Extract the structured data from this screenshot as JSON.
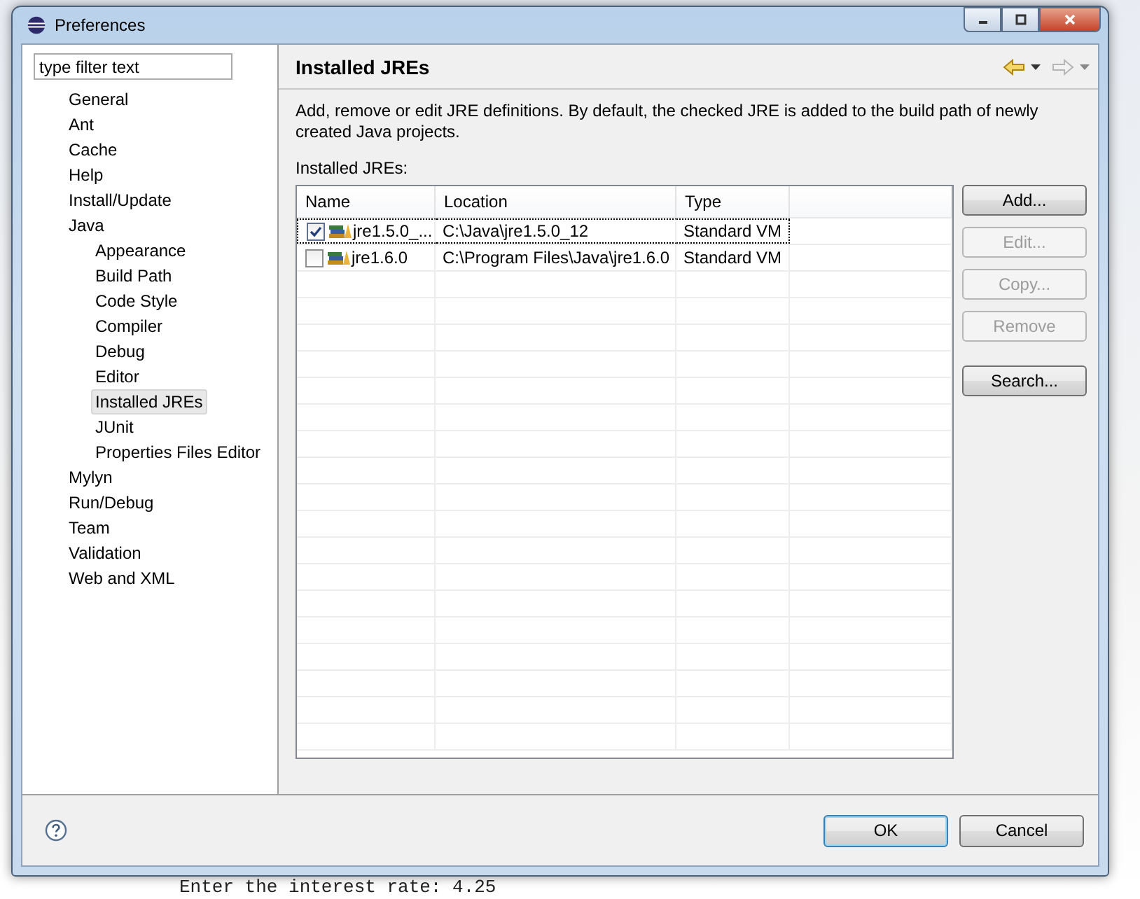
{
  "window": {
    "title": "Preferences"
  },
  "background": {
    "console_line": "Enter the interest rate: 4.25"
  },
  "filter": {
    "placeholder": "type filter text"
  },
  "tree": [
    {
      "label": "General",
      "selected": false
    },
    {
      "label": "Ant",
      "selected": false
    },
    {
      "label": "Cache",
      "selected": false
    },
    {
      "label": "Help",
      "selected": false
    },
    {
      "label": "Install/Update",
      "selected": false
    },
    {
      "label": "Java",
      "selected": false,
      "children": [
        {
          "label": "Appearance",
          "selected": false
        },
        {
          "label": "Build Path",
          "selected": false
        },
        {
          "label": "Code Style",
          "selected": false
        },
        {
          "label": "Compiler",
          "selected": false
        },
        {
          "label": "Debug",
          "selected": false
        },
        {
          "label": "Editor",
          "selected": false
        },
        {
          "label": "Installed JREs",
          "selected": true
        },
        {
          "label": "JUnit",
          "selected": false
        },
        {
          "label": "Properties Files Editor",
          "selected": false
        }
      ]
    },
    {
      "label": "Mylyn",
      "selected": false
    },
    {
      "label": "Run/Debug",
      "selected": false
    },
    {
      "label": "Team",
      "selected": false
    },
    {
      "label": "Validation",
      "selected": false
    },
    {
      "label": "Web and XML",
      "selected": false
    }
  ],
  "page": {
    "title": "Installed JREs",
    "description": "Add, remove or edit JRE definitions. By default, the checked JRE is added to the build path of newly created Java projects.",
    "list_label": "Installed JREs:"
  },
  "table": {
    "columns": [
      "Name",
      "Location",
      "Type"
    ],
    "rows": [
      {
        "name": "jre1.5.0_...",
        "location": "C:\\Java\\jre1.5.0_12",
        "type": "Standard VM",
        "checked": true,
        "selected": true
      },
      {
        "name": "jre1.6.0",
        "location": "C:\\Program Files\\Java\\jre1.6.0",
        "type": "Standard VM",
        "checked": false,
        "selected": false
      }
    ]
  },
  "side_buttons": [
    {
      "label": "Add...",
      "disabled": false
    },
    {
      "label": "Edit...",
      "disabled": true
    },
    {
      "label": "Copy...",
      "disabled": true
    },
    {
      "label": "Remove",
      "disabled": true
    },
    {
      "label": "Search...",
      "disabled": false
    }
  ],
  "footer": {
    "buttons": [
      {
        "label": "OK",
        "default": true
      },
      {
        "label": "Cancel",
        "default": false
      }
    ]
  }
}
